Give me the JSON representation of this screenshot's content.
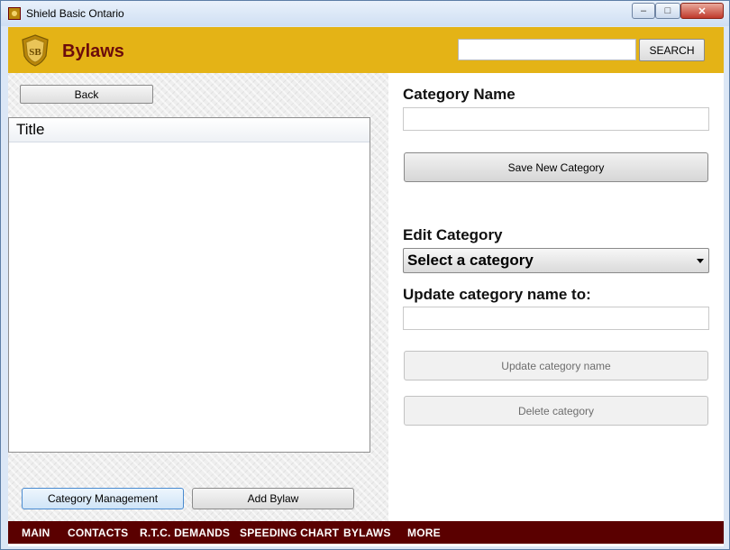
{
  "window": {
    "title": "Shield Basic Ontario",
    "controls": {
      "minimize": "–",
      "maximize": "□",
      "close": "✕"
    }
  },
  "header": {
    "logo_text": "SB",
    "page_title": "Bylaws",
    "search": {
      "value": "",
      "placeholder": "",
      "button_label": "SEARCH"
    }
  },
  "left_panel": {
    "back_label": "Back",
    "list": {
      "column_header": "Title",
      "rows": []
    },
    "category_management_label": "Category Management",
    "add_bylaw_label": "Add Bylaw"
  },
  "right_panel": {
    "category_name_label": "Category Name",
    "category_name_value": "",
    "save_new_category_label": "Save New Category",
    "edit_category_label": "Edit Category",
    "select_category_value": "Select a category",
    "update_name_label": "Update category name to:",
    "update_name_value": "",
    "update_button_label": "Update category name",
    "delete_button_label": "Delete category"
  },
  "nav": {
    "items": [
      "MAIN",
      "CONTACTS",
      "R.T.C. DEMANDS",
      "SPEEDING CHART",
      "BYLAWS",
      "MORE"
    ]
  },
  "colors": {
    "header_bg": "#e4b316",
    "title_color": "#6b0c0c",
    "nav_bg": "#5a0000",
    "nav_text": "#ffffff"
  }
}
